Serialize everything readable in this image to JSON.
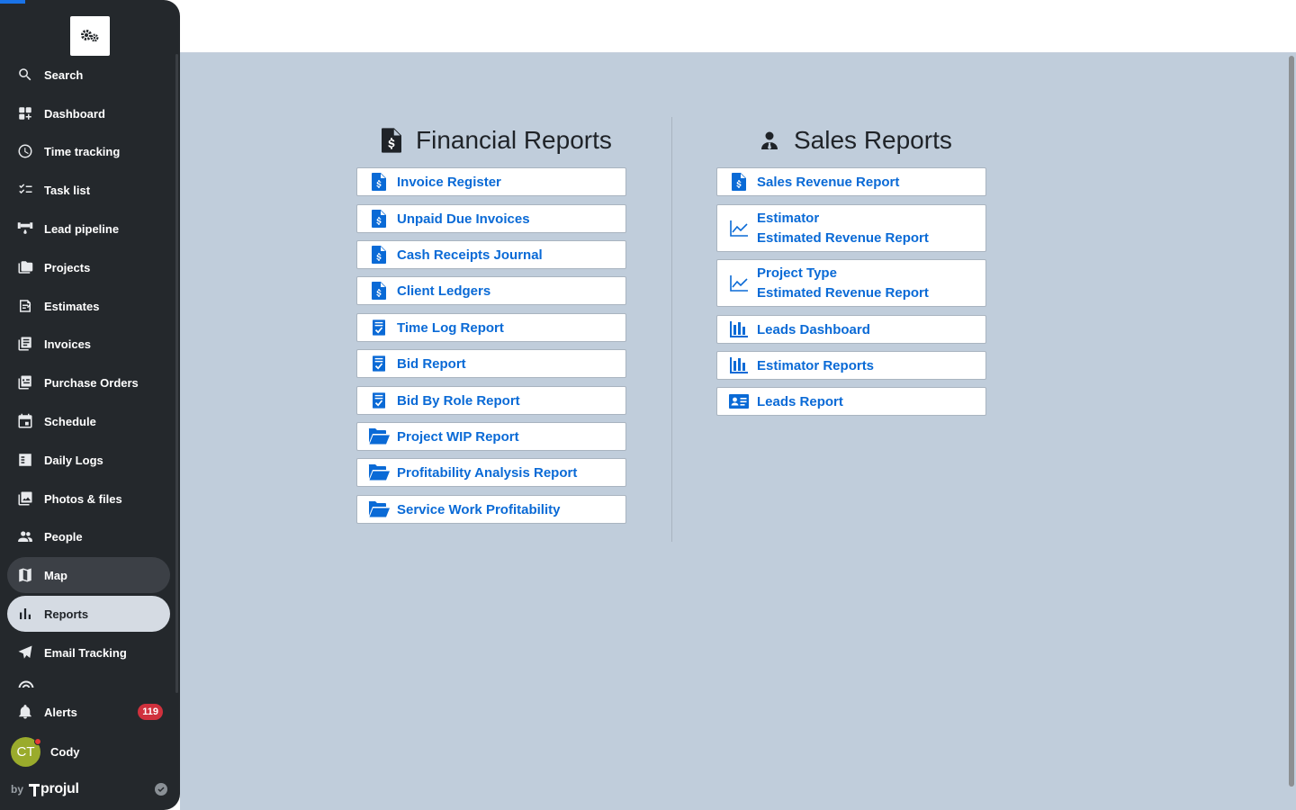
{
  "sidebar": {
    "logo_icon": "gears-icon",
    "items": [
      {
        "label": "Search",
        "icon": "search-icon"
      },
      {
        "label": "Dashboard",
        "icon": "dashboard-icon"
      },
      {
        "label": "Time tracking",
        "icon": "clock-icon"
      },
      {
        "label": "Task list",
        "icon": "checklist-icon"
      },
      {
        "label": "Lead pipeline",
        "icon": "pipeline-icon"
      },
      {
        "label": "Projects",
        "icon": "folders-icon"
      },
      {
        "label": "Estimates",
        "icon": "estimate-icon"
      },
      {
        "label": "Invoices",
        "icon": "invoice-icon"
      },
      {
        "label": "Purchase Orders",
        "icon": "purchase-order-icon"
      },
      {
        "label": "Schedule",
        "icon": "calendar-icon"
      },
      {
        "label": "Daily Logs",
        "icon": "daily-log-icon"
      },
      {
        "label": "Photos & files",
        "icon": "photos-icon"
      },
      {
        "label": "People",
        "icon": "people-icon"
      },
      {
        "label": "Map",
        "icon": "map-icon"
      },
      {
        "label": "Reports",
        "icon": "bar-chart-icon"
      },
      {
        "label": "Email Tracking",
        "icon": "send-icon"
      }
    ],
    "active_item": "Reports",
    "hover_item": "Map",
    "alerts": {
      "label": "Alerts",
      "count": "119"
    },
    "user": {
      "initials": "CT",
      "name": "Cody"
    },
    "footer": {
      "by": "by",
      "brand": "projul"
    }
  },
  "financial": {
    "title": "Financial Reports",
    "icon": "file-invoice-dollar-icon",
    "items": [
      {
        "label": "Invoice Register",
        "icon": "file-dollar-icon"
      },
      {
        "label": "Unpaid Due Invoices",
        "icon": "file-dollar-icon"
      },
      {
        "label": "Cash Receipts Journal",
        "icon": "file-dollar-icon"
      },
      {
        "label": "Client Ledgers",
        "icon": "file-dollar-icon"
      },
      {
        "label": "Time Log Report",
        "icon": "checklist-doc-icon"
      },
      {
        "label": "Bid Report",
        "icon": "checklist-doc-icon"
      },
      {
        "label": "Bid By Role Report",
        "icon": "checklist-doc-icon"
      },
      {
        "label": "Project WIP Report",
        "icon": "folder-open-icon"
      },
      {
        "label": "Profitability Analysis Report",
        "icon": "folder-open-icon"
      },
      {
        "label": "Service Work Profitability",
        "icon": "folder-open-icon"
      }
    ]
  },
  "sales": {
    "title": "Sales Reports",
    "icon": "user-tie-icon",
    "items": [
      {
        "label": "Sales Revenue Report",
        "icon": "file-dollar-icon"
      },
      {
        "line1": "Estimator",
        "line2": "Estimated Revenue Report",
        "icon": "line-chart-icon"
      },
      {
        "line1": "Project Type",
        "line2": "Estimated Revenue Report",
        "icon": "line-chart-icon"
      },
      {
        "label": "Leads Dashboard",
        "icon": "bar-chart-icon"
      },
      {
        "label": "Estimator Reports",
        "icon": "bar-chart-icon"
      },
      {
        "label": "Leads Report",
        "icon": "id-card-icon"
      }
    ]
  }
}
